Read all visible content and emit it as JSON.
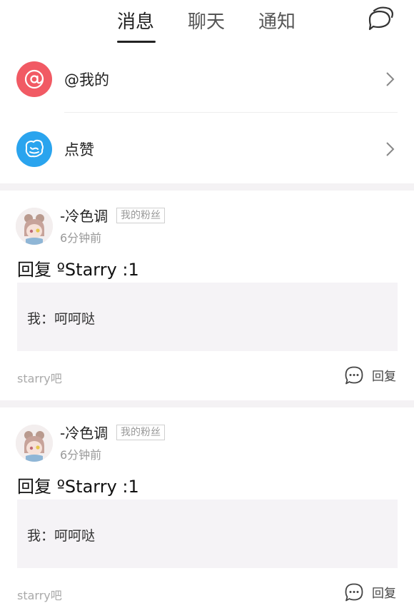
{
  "tabs": [
    {
      "label": "消息",
      "active": true
    },
    {
      "label": "聊天",
      "active": false
    },
    {
      "label": "通知",
      "active": false
    }
  ],
  "header": {
    "chat_icon": "chat-bubbles-icon"
  },
  "menu": [
    {
      "label": "@我的",
      "icon": "at-icon",
      "color": "#f15a64"
    },
    {
      "label": "点赞",
      "icon": "thumbs-up-icon",
      "color": "#2aa4ee"
    }
  ],
  "notifications": [
    {
      "username": "-冷色调",
      "tag": "我的粉丝",
      "time": "6分钟前",
      "title": "回复 ºStarry :1",
      "quote": "我：呵呵哒",
      "forum": "starry吧",
      "reply_label": "回复"
    },
    {
      "username": "-冷色调",
      "tag": "我的粉丝",
      "time": "6分钟前",
      "title": "回复 ºStarry :1",
      "quote": "我：呵呵哒",
      "forum": "starry吧",
      "reply_label": "回复"
    }
  ]
}
